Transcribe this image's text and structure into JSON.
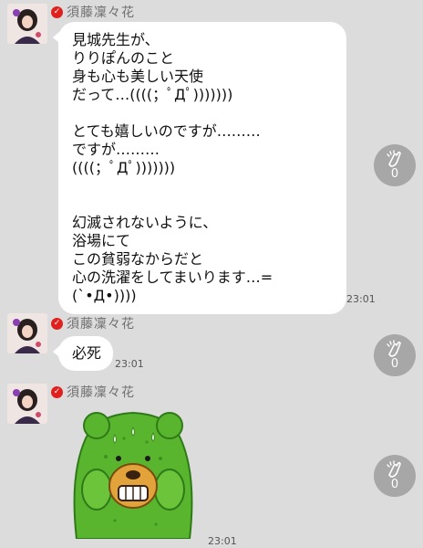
{
  "messages": [
    {
      "sender": "須藤凜々花",
      "text": "見城先生が、\nりりぽんのこと\n身も心も美しい天使\nだって…((((；ﾟДﾟ)))))))\n\nとても嬉しいのですが………\nですが………\n((((；ﾟДﾟ)))))))\n\n\n幻滅されないように、\n浴場にて\nこの貧弱なからだと\n心の洗濯をしてまいります…=(`•Д•))))",
      "time": "23:01",
      "clap_count": "0"
    },
    {
      "sender": "須藤凜々花",
      "text": "必死",
      "time": "23:01",
      "clap_count": "0"
    },
    {
      "sender": "須藤凜々花",
      "sticker": "green-bear-sticker",
      "time": "23:01",
      "clap_count": "0"
    }
  ],
  "icons": {
    "verified": "verified-badge-icon",
    "clap": "clap-icon"
  },
  "colors": {
    "background": "#dcdcdc",
    "bubble": "#ffffff",
    "verified": "#e0201c",
    "clap_button": "#a7a7a7",
    "sticker_green": "#5ab52e"
  }
}
